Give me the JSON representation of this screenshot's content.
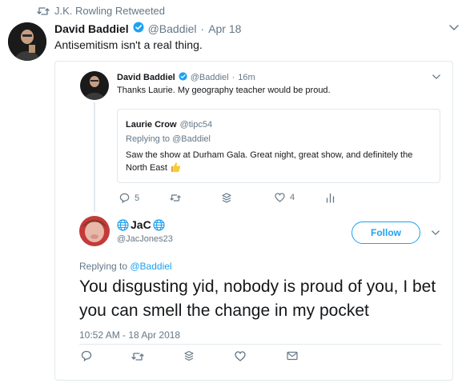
{
  "retweet": {
    "label": "J.K. Rowling Retweeted"
  },
  "outer_tweet": {
    "author_name": "David Baddiel",
    "author_handle": "@Baddiel",
    "date": "Apr 18",
    "text": "Antisemitism isn't a real thing."
  },
  "quoted_tweet": {
    "author_name": "David Baddiel",
    "author_handle": "@Baddiel",
    "time": "16m",
    "text": "Thanks Laurie. My geography teacher would be proud.",
    "nested_quote": {
      "author_name": "Laurie Crow",
      "author_handle": "@tipc54",
      "replying_to_prefix": "Replying to ",
      "replying_to_handle": "@Baddiel",
      "text": "Saw the show at Durham Gala. Great night, great show, and definitely the North East"
    },
    "actions": {
      "reply_count": "5",
      "like_count": "4"
    }
  },
  "reply_tweet": {
    "author_name": "JaC",
    "author_handle": "@JacJones23",
    "follow_label": "Follow",
    "replying_to_prefix": "Replying to ",
    "replying_to_handle": "@Baddiel",
    "text": "You disgusting yid, nobody is proud of you, I bet you can smell the change in my pocket",
    "timestamp": "10:52 AM - 18 Apr 2018"
  },
  "colors": {
    "brand": "#1da1f2",
    "muted": "#657786",
    "border": "#e1e8ed",
    "text": "#14171a"
  },
  "icons": [
    "retweet-icon",
    "verified-icon",
    "chevron-down-icon",
    "reply-icon",
    "stack-icon",
    "heart-icon",
    "analytics-icon",
    "mail-icon",
    "globe-icon",
    "thumbs-up-emoji"
  ]
}
